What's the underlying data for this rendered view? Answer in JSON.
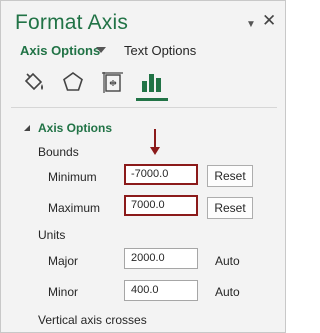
{
  "pane": {
    "title": "Format Axis",
    "pin_icon": "pin-dropdown-icon",
    "close_icon": "close-icon"
  },
  "tabs": {
    "active": "Axis Options",
    "inactive": "Text Options"
  },
  "icons": [
    "fill-line-icon",
    "effects-pentagon-icon",
    "size-properties-icon",
    "axis-options-bar-icon"
  ],
  "section": {
    "title": "Axis Options"
  },
  "bounds": {
    "label": "Bounds",
    "minimum_label": "Minimum",
    "minimum_value": "-7000.0",
    "maximum_label": "Maximum",
    "maximum_value": "7000.0",
    "reset_label": "Reset"
  },
  "units": {
    "label": "Units",
    "major_label": "Major",
    "major_value": "2000.0",
    "minor_label": "Minor",
    "minor_value": "400.0",
    "auto_label": "Auto"
  },
  "crosses": {
    "label": "Vertical axis crosses"
  },
  "colors": {
    "accent": "#217346",
    "highlight": "#8b1a1a"
  }
}
